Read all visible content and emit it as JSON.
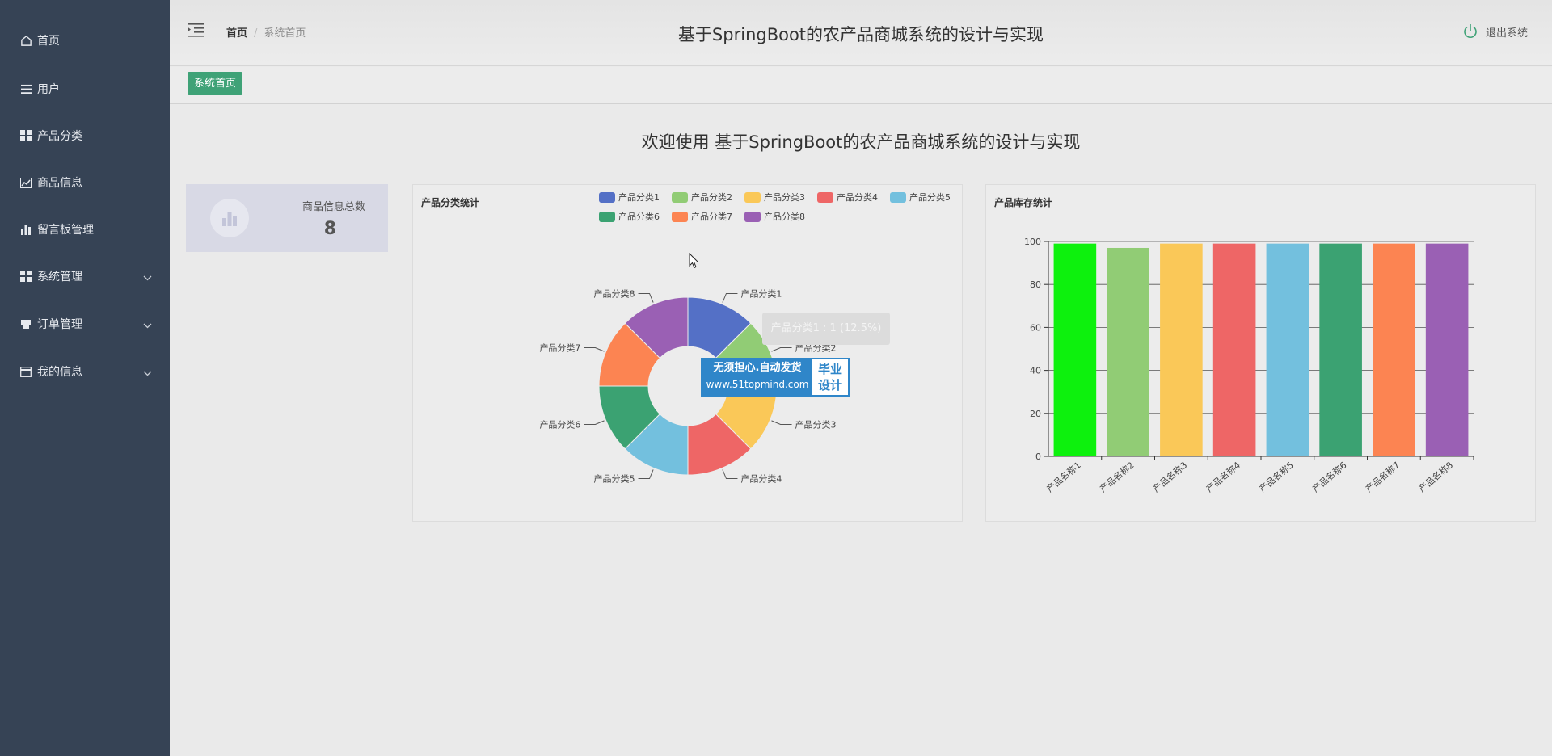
{
  "sidebar": {
    "items": [
      {
        "label": "首页",
        "icon": "home-icon"
      },
      {
        "label": "用户",
        "icon": "list-icon"
      },
      {
        "label": "产品分类",
        "icon": "grid-icon"
      },
      {
        "label": "商品信息",
        "icon": "chart-line-icon"
      },
      {
        "label": "留言板管理",
        "icon": "bar-chart-icon"
      },
      {
        "label": "系统管理",
        "icon": "grid-icon",
        "expandable": true
      },
      {
        "label": "订单管理",
        "icon": "printer-icon",
        "expandable": true
      },
      {
        "label": "我的信息",
        "icon": "card-icon",
        "expandable": true
      }
    ]
  },
  "header": {
    "breadcrumb_home": "首页",
    "breadcrumb_sep": "/",
    "breadcrumb_current": "系统首页",
    "title": "基于SpringBoot的农产品商城系统的设计与实现",
    "logout_label": "退出系统"
  },
  "tabs": {
    "active": "系统首页"
  },
  "welcome": "欢迎使用 基于SpringBoot的农产品商城系统的设计与实现",
  "stat_card": {
    "label": "商品信息总数",
    "value": "8"
  },
  "tooltip": "产品分类1 : 1 (12.5%)",
  "watermark": {
    "line1": "无须担心.自动发货",
    "line2": "www.51topmind.com",
    "right1": "毕业",
    "right2": "设计"
  },
  "colors": {
    "sidebar_bg": "#364355",
    "accent_green": "#3fa277",
    "series": [
      "#5470c6",
      "#91cc75",
      "#fac858",
      "#ee6666",
      "#73c0de",
      "#3ba272",
      "#fc8452",
      "#9a60b4"
    ]
  },
  "chart_data": [
    {
      "type": "pie",
      "title": "产品分类统计",
      "donut": true,
      "legend_position": "top-right",
      "categories": [
        "产品分类1",
        "产品分类2",
        "产品分类3",
        "产品分类4",
        "产品分类5",
        "产品分类6",
        "产品分类7",
        "产品分类8"
      ],
      "values": [
        1,
        1,
        1,
        1,
        1,
        1,
        1,
        1
      ]
    },
    {
      "type": "bar",
      "title": "产品库存统计",
      "categories": [
        "产品名称1",
        "产品名称2",
        "产品名称3",
        "产品名称4",
        "产品名称5",
        "产品名称6",
        "产品名称7",
        "产品名称8"
      ],
      "values": [
        99,
        97,
        99,
        99,
        99,
        99,
        99,
        99
      ],
      "bar_colors": [
        "#0df10d",
        "#91cc75",
        "#fac858",
        "#ee6666",
        "#73c0de",
        "#3ba272",
        "#fc8452",
        "#9a60b4"
      ],
      "ylim": [
        0,
        100
      ],
      "yticks": [
        0,
        20,
        40,
        60,
        80,
        100
      ],
      "grid": true
    }
  ]
}
